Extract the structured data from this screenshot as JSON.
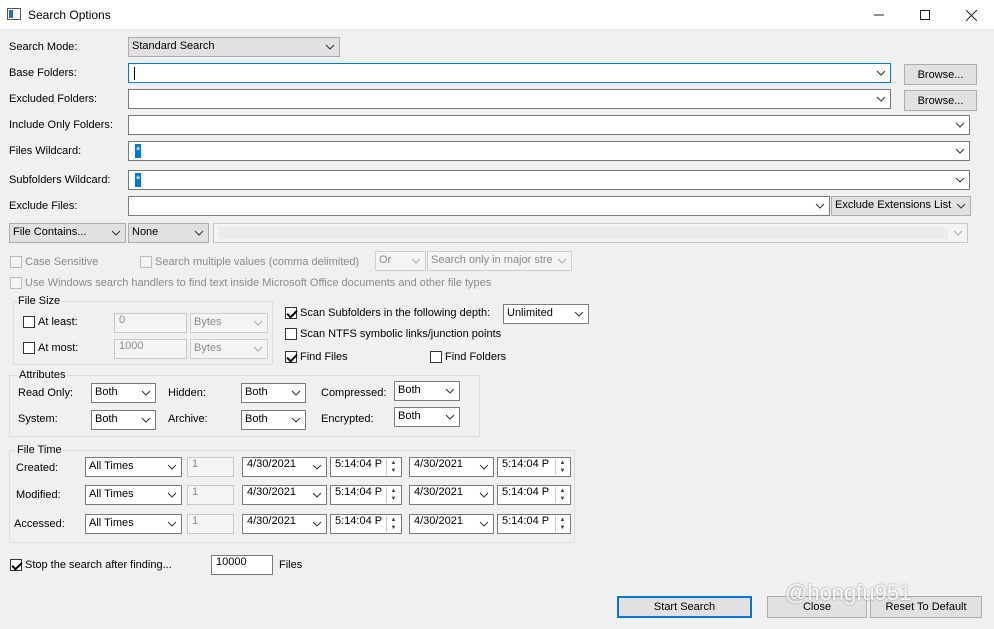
{
  "window": {
    "title": "Search Options"
  },
  "search_mode": {
    "label": "Search Mode:",
    "value": "Standard Search"
  },
  "base_folders": {
    "label": "Base Folders:",
    "value": "",
    "browse": "Browse..."
  },
  "excluded_folders": {
    "label": "Excluded Folders:",
    "value": "",
    "browse": "Browse..."
  },
  "include_only_folders": {
    "label": "Include Only Folders:",
    "value": ""
  },
  "files_wildcard": {
    "label": "Files Wildcard:",
    "value": "*"
  },
  "subfolders_wildcard": {
    "label": "Subfolders Wildcard:",
    "value": "*"
  },
  "exclude_files": {
    "label": "Exclude Files:",
    "value": "",
    "list": "Exclude Extensions List"
  },
  "file_contains": {
    "mode": "File Contains...",
    "encoding": "None",
    "text": ""
  },
  "options": {
    "case_sensitive": "Case Sensitive",
    "multiple_values": "Search multiple values (comma delimited)",
    "or": "Or",
    "major_stream": "Search only in major stre",
    "windows_handlers": "Use Windows search handlers to find text inside Microsoft Office documents and other file types"
  },
  "file_size": {
    "title": "File Size",
    "at_least": {
      "label": "At least:",
      "value": "0",
      "unit": "Bytes"
    },
    "at_most": {
      "label": "At most:",
      "value": "1000",
      "unit": "Bytes"
    }
  },
  "scan": {
    "subfolders_label": "Scan Subfolders in the following depth:",
    "depth": "Unlimited",
    "ntfs_label": "Scan NTFS symbolic links/junction points",
    "find_files": "Find Files",
    "find_folders": "Find Folders"
  },
  "attributes": {
    "title": "Attributes",
    "read_only": {
      "label": "Read Only:",
      "value": "Both"
    },
    "hidden": {
      "label": "Hidden:",
      "value": "Both"
    },
    "compressed": {
      "label": "Compressed:",
      "value": "Both"
    },
    "system": {
      "label": "System:",
      "value": "Both"
    },
    "archive": {
      "label": "Archive:",
      "value": "Both"
    },
    "encrypted": {
      "label": "Encrypted:",
      "value": "Both"
    }
  },
  "file_time": {
    "title": "File Time",
    "rows": [
      {
        "label": "Created:",
        "mode": "All Times",
        "num": "1",
        "date1": "4/30/2021",
        "time1": "5:14:04 P",
        "date2": "4/30/2021",
        "time2": "5:14:04 P"
      },
      {
        "label": "Modified:",
        "mode": "All Times",
        "num": "1",
        "date1": "4/30/2021",
        "time1": "5:14:04 P",
        "date2": "4/30/2021",
        "time2": "5:14:04 P"
      },
      {
        "label": "Accessed:",
        "mode": "All Times",
        "num": "1",
        "date1": "4/30/2021",
        "time1": "5:14:04 P",
        "date2": "4/30/2021",
        "time2": "5:14:04 P"
      }
    ]
  },
  "stop": {
    "label": "Stop the search after finding...",
    "value": "10000",
    "unit": "Files"
  },
  "buttons": {
    "start": "Start Search",
    "close": "Close",
    "reset": "Reset To Default"
  },
  "watermark": "@hongfu951"
}
